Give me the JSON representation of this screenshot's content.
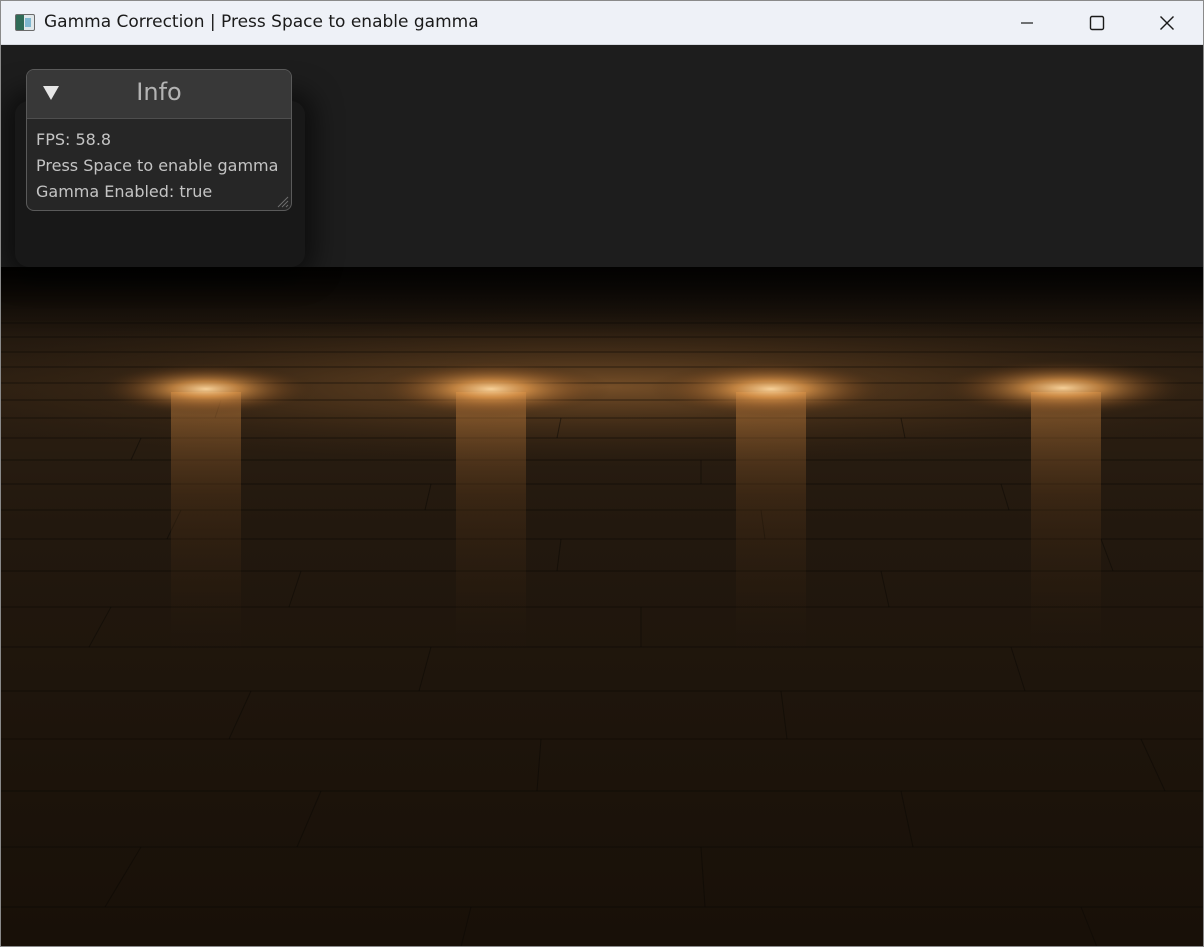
{
  "window": {
    "title": "Gamma Correction | Press Space to enable gamma",
    "icon": "app-icon",
    "controls": {
      "minimize_icon": "minimize-icon",
      "maximize_icon": "maximize-icon",
      "close_icon": "close-icon"
    }
  },
  "info_panel": {
    "title": "Info",
    "collapse_icon": "collapse-triangle-icon",
    "lines": [
      "FPS: 58.8",
      "Press Space to enable gamma",
      "Gamma Enabled: true"
    ]
  },
  "scene": {
    "light_count": 4,
    "light_color": "#ffb25a",
    "floor_color": "#2c1f12",
    "background_color": "#1d1d1d"
  }
}
